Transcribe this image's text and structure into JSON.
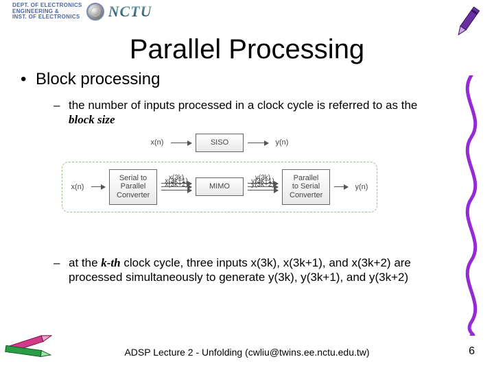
{
  "header": {
    "dept_line1": "Dept. of Electronics",
    "dept_line2": "Engineering &",
    "dept_line3": "Inst. of Electronics",
    "univ": "NCTU"
  },
  "title": "Parallel Processing",
  "bullets": {
    "b1": "Block processing",
    "sub_a_pre": "the number of inputs processed in a clock cycle is referred to as the ",
    "sub_a_em": "block size",
    "sub_b_pre": "at the ",
    "sub_b_em": "k-th",
    "sub_b_post": " clock cycle, three inputs x(3k), x(3k+1), and x(3k+2) are processed simultaneously to generate y(3k), y(3k+1), and y(3k+2)"
  },
  "diagram": {
    "siso": {
      "in": "x(n)",
      "box": "SISO",
      "out": "y(n)"
    },
    "mimo": {
      "in_outer": "x(n)",
      "s2p": "Serial to\nParallel\nConverter",
      "x_sigs": [
        "x(3k)",
        "x(3k+1)",
        "x(3k+2)"
      ],
      "core": "MIMO",
      "y_sigs": [
        "y(3k)",
        "y(3k+1)",
        "y(3k+2)"
      ],
      "p2s": "Parallel\nto Serial\nConverter",
      "out_outer": "y(n)"
    }
  },
  "footer": "ADSP Lecture 2 - Unfolding   (cwliu@twins.ee.nctu.edu.tw)",
  "page": "6"
}
